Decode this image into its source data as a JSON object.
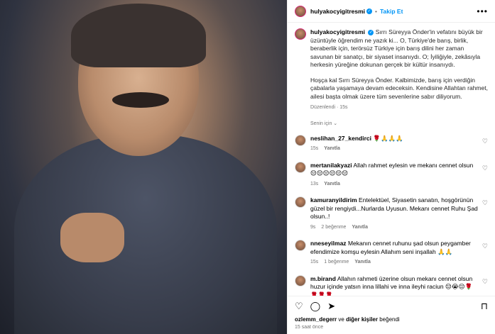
{
  "header": {
    "username": "hulyakocyigitresmi",
    "separator": "•",
    "follow_label": "Takip Et",
    "more_label": "•••",
    "verified_mark": "✓"
  },
  "caption": {
    "username": "hulyakocyigitresmi",
    "paragraph1": "Sırrı Süreyya Önder'in vefatını büyük bir üzüntüyle öğrendim ne yazık ki... O, Türkiye'de barış, birlik, beraberlik için, terörsüz Türkiye için barış dilini her zaman savunan bir sanatçı, bir siyaset insanıydı. O; İyiliğiyle, zekâsıyla herkesin yüreğine dokunan gerçek bir kültür insanıydı.",
    "paragraph2": "Hoşça kal Sırrı Süreyya Önder. Kalbimizde, barış için verdiğin çabalarla yaşamaya devam edeceksin. Kendisine Allahtan rahmet, ailesi başta olmak üzere tüm sevenlerine sabır diliyorum.",
    "meta": "Düzenlendi · 15s"
  },
  "translation": "Senin için ⌄",
  "comments": [
    {
      "user": "neslihan_27_kendirci",
      "text": "🌹🙏🙏🙏",
      "time": "15s",
      "likes": "",
      "reply": "Yanıtla"
    },
    {
      "user": "mertanilakyazi",
      "text": "Allah rahmet eylesin ve mekanı cennet olsun 😔😔😔😔😔😔",
      "time": "13s",
      "likes": "",
      "reply": "Yanıtla"
    },
    {
      "user": "kamuranyildirim",
      "text": "Entelektüel, Siyasetin sanatın, hoşgörünün güzel bir rengiydi...Nurlarda Uyusun. Mekanı cennet Ruhu Şad olsun..!",
      "time": "9s",
      "likes": "2 beğenme",
      "reply": "Yanıtla"
    },
    {
      "user": "nneseyilmaz",
      "text": "Mekanın cennet ruhunu şad olsun peygamber efendimize komşu eylesin Allahım seni inşallah 🙏🙏",
      "time": "15s",
      "likes": "1 beğenme",
      "reply": "Yanıtla"
    },
    {
      "user": "m.birand",
      "text": "Allahın rahmeti üzerine olsun mekanı cennet olsun huzur içinde yatsın inna lillahi ve inna ileyhi raciun 😔😭😔🌹 🌹🌹🌹",
      "time": "",
      "likes": "",
      "reply": ""
    }
  ],
  "actions": {
    "like_icon": "♡",
    "comment_icon": "◯",
    "share_icon": "➤",
    "save_icon": "⊓",
    "heart_icon": "♡"
  },
  "likes": {
    "user": "ozlemm_degerr",
    "rest": "ve",
    "others": "diğer kişiler",
    "suffix": "beğendi"
  },
  "time": "15 saat önce"
}
